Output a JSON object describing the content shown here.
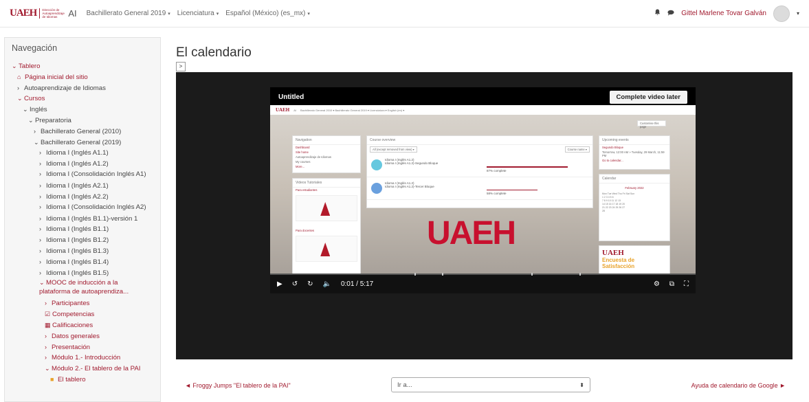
{
  "header": {
    "logo_text": "UAEH",
    "logo_sub": "Dirección de Autoaprendizaje de Idiomas",
    "brand": "AI",
    "menu": [
      {
        "label": "Bachillerato General 2019",
        "caret": "▾"
      },
      {
        "label": "Licenciatura",
        "caret": "▾"
      },
      {
        "label": "Español (México) (es_mx)",
        "caret": "▾"
      }
    ],
    "user_name": "Gittel Marlene Tovar Galván",
    "bell_icon": "bell-icon",
    "chat_icon": "chat-icon"
  },
  "leftnav": {
    "title": "Navegación",
    "items": {
      "tablero": "Tablero",
      "inicio": "Página inicial del sitio",
      "autoaprendizaje": "Autoaprendizaje de Idiomas",
      "cursos": "Cursos",
      "ingles": "Inglés",
      "preparatoria": "Preparatoria",
      "bach2010": "Bachillerato General (2010)",
      "bach2019": "Bachillerato General (2019)",
      "a11": "Idioma I (Inglés A1.1)",
      "a12": "Idioma I (Inglés A1.2)",
      "consa1": "Idioma I (Consolidación Inglés A1)",
      "a21": "Idioma I (Inglés A2.1)",
      "a22": "Idioma I (Inglés A2.2)",
      "consa2": "Idioma I (Consolidación Inglés A2)",
      "b11v1": "Idioma I (Inglés B1.1)-versión 1",
      "b11": "Idioma I (Inglés B1.1)",
      "b12": "Idioma I (Inglés B1.2)",
      "b13": "Idioma I (Inglés B1.3)",
      "b14": "Idioma I (Inglés B1.4)",
      "b15": "Idioma I (Inglés B1.5)",
      "mooc": "MOOC de inducción a la plataforma de autoaprendiza...",
      "participantes": "Participantes",
      "competencias": "Competencias",
      "calificaciones": "Calificaciones",
      "datos": "Datos generales",
      "presentacion": "Presentación",
      "modulo1": "Módulo 1.- Introducción",
      "modulo2": "Módulo 2.- El tablero de la PAI",
      "eltablero": "El tablero"
    }
  },
  "main": {
    "title": "El calendario",
    "toggle": ">"
  },
  "video": {
    "title": "Untitled",
    "later_button": "Complete video later",
    "time": "0:01 / 5:17",
    "inner": {
      "brand": "AI",
      "nav_text": "Bachillerato General 2010 ▾  Bachillerato General 2019 ▾  Licenciatura ▾  English (en) ▾",
      "customise": "Customise this page",
      "navigation_header": "Navigation",
      "navigation_items": [
        "Dashboard",
        "Site home",
        "Autoaprendizaje de Idiomas",
        "My courses",
        "More..."
      ],
      "videos_header": "Videos Tutoriales",
      "for_students": "Para estudiantes",
      "for_teachers": "Para docentes",
      "course_overview": "Course overview",
      "filter": "All (except removed from view) ▾",
      "course_name_btn": "Course name ▾",
      "course1_cat": "Idioma I (Inglés A1.2)",
      "course1_name": "Idioma I (Inglés A1.2)-Segundo Bloque",
      "course1_progress": "87% complete",
      "course2_cat": "Idioma I (Inglés A1.2)",
      "course2_name": "Idioma I (Inglés A1.2)-Tercer Bloque",
      "course2_progress": "58% complete",
      "upcoming_header": "Upcoming events",
      "upcoming_event": "Segundo Bloque",
      "upcoming_when": "Tomorrow, 12:00 AM » Tuesday, 29 March, 11:59 PM",
      "go_calendar": "Go to calendar...",
      "calendar_header": "Calendar",
      "calendar_month": "February 2022",
      "calendar_days": "Mon  Tue  Wed  Thu  Fri  Sat  Sun",
      "calendar_rows": [
        "1  2  3  4  5  6",
        "7  8  9  10  11  12  13",
        "14  15  16  17  18  19  20",
        "21  22  23  24  25  26  27",
        "28"
      ],
      "promo_brand": "UAEH",
      "promo_line1": "Encuesta de",
      "promo_line2": "Satisfacción",
      "big_logo": "UAEH"
    }
  },
  "bottom": {
    "prev": "◄ Froggy Jumps \"El tablero de la PAI\"",
    "jump_placeholder": "Ir a...",
    "next": "Ayuda de calendario de Google ►"
  },
  "colors": {
    "brand": "#a11a2e",
    "video_bg": "#1b1b1b"
  }
}
